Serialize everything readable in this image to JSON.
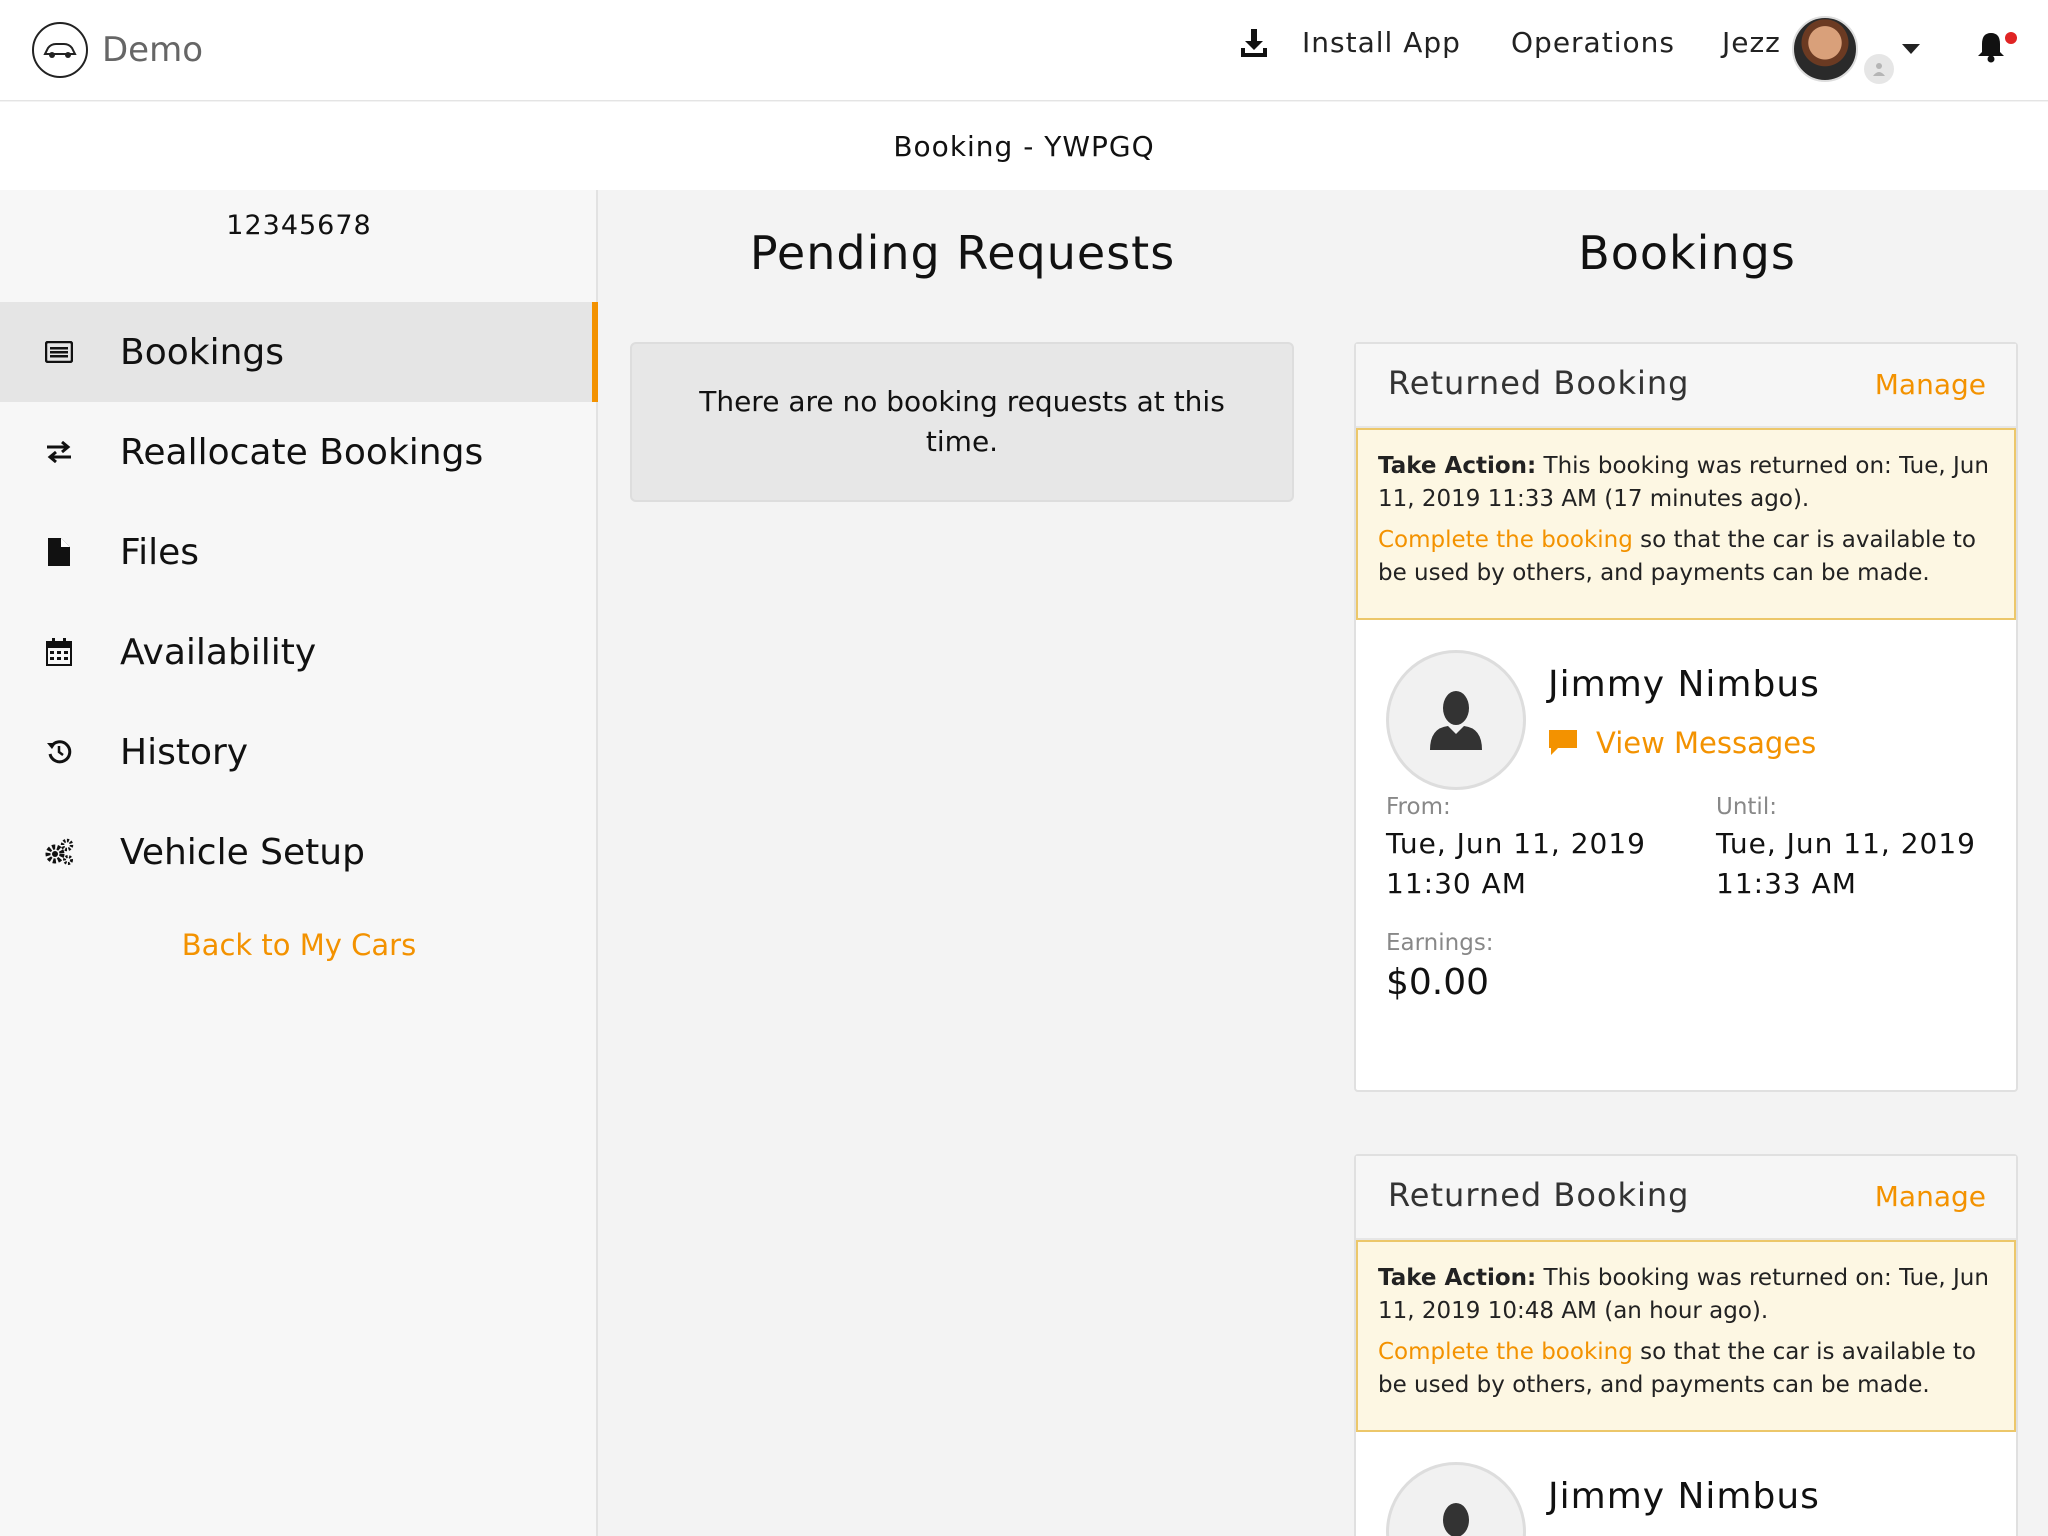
{
  "header": {
    "brand": "Demo",
    "install_app": "Install App",
    "operations": "Operations",
    "user_name": "Jezz"
  },
  "subheader": {
    "title": "Booking - YWPGQ"
  },
  "sidebar": {
    "plate": "12345678",
    "items": [
      {
        "label": "Bookings",
        "icon": "list-icon",
        "active": true
      },
      {
        "label": "Reallocate Bookings",
        "icon": "swap-icon"
      },
      {
        "label": "Files",
        "icon": "file-icon"
      },
      {
        "label": "Availability",
        "icon": "calendar-icon"
      },
      {
        "label": "History",
        "icon": "history-icon"
      },
      {
        "label": "Vehicle Setup",
        "icon": "gears-icon"
      }
    ],
    "back_link": "Back to My Cars"
  },
  "pending": {
    "title": "Pending Requests",
    "empty_text": "There are no booking requests at this time."
  },
  "bookings": {
    "title": "Bookings",
    "cards": [
      {
        "status": "Returned Booking",
        "manage": "Manage",
        "alert_label": "Take Action:",
        "alert_text": "This booking was returned on: Tue, Jun 11, 2019 11:33 AM (17 minutes ago).",
        "alert_link": "Complete the booking",
        "alert_tail": "so that the car is available to be used by others, and payments can be made.",
        "person": "Jimmy Nimbus",
        "view_messages": "View Messages",
        "from_label": "From:",
        "from_date": "Tue, Jun 11, 2019",
        "from_time": "11:30 AM",
        "until_label": "Until:",
        "until_date": "Tue, Jun 11, 2019",
        "until_time": "11:33 AM",
        "earnings_label": "Earnings:",
        "earnings": "$0.00"
      },
      {
        "status": "Returned Booking",
        "manage": "Manage",
        "alert_label": "Take Action:",
        "alert_text": "This booking was returned on: Tue, Jun 11, 2019 10:48 AM (an hour ago).",
        "alert_link": "Complete the booking",
        "alert_tail": "so that the car is available to be used by others, and payments can be made.",
        "person": "Jimmy Nimbus"
      }
    ]
  },
  "colors": {
    "accent": "#f39200",
    "alert_bg": "#fdf7e3",
    "alert_border": "#ecc76a",
    "notification_dot": "#e02424"
  }
}
